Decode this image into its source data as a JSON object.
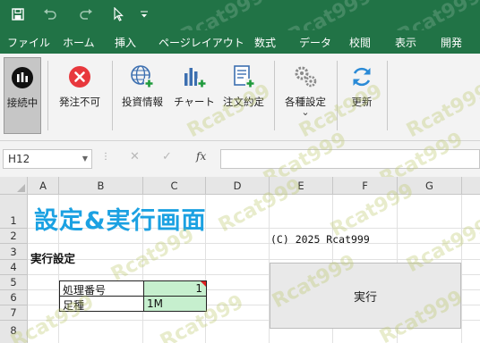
{
  "quick_access": {
    "save_icon": "save-icon",
    "undo_icon": "undo-icon",
    "redo_icon": "redo-icon",
    "select_icon": "cursor-icon",
    "customize_icon": "customize-icon"
  },
  "menu": [
    "ファイル",
    "ホーム",
    "挿入",
    "ページレイアウト",
    "数式",
    "データ",
    "校閲",
    "表示",
    "開発"
  ],
  "ribbon": {
    "connected": "接続中",
    "no_order": "発注不可",
    "investment_info": "投資情報",
    "chart": "チャート",
    "order_execution": "注文約定",
    "settings": "各種設定",
    "settings_chevron": "⌄",
    "refresh": "更新"
  },
  "formula_bar": {
    "name_box": "H12",
    "fx": "fx",
    "value": ""
  },
  "columns": [
    "A",
    "B",
    "C",
    "D",
    "E",
    "F",
    "G"
  ],
  "rows": [
    "1",
    "2",
    "3",
    "4",
    "5",
    "6",
    "7",
    "8"
  ],
  "sheet": {
    "title": "設定&実行画面",
    "copyright": "(C) 2025 Rcat999",
    "section": "実行設定",
    "table": [
      {
        "label": "処理番号",
        "value": "1"
      },
      {
        "label": "足種",
        "value": "1M"
      }
    ],
    "run_button": "実行"
  },
  "watermark": "Rcat999",
  "colors": {
    "app_green": "#217346",
    "title_blue": "#1ba1e2",
    "value_cell_green": "#c6efce",
    "comment_marker": "#e02020"
  }
}
